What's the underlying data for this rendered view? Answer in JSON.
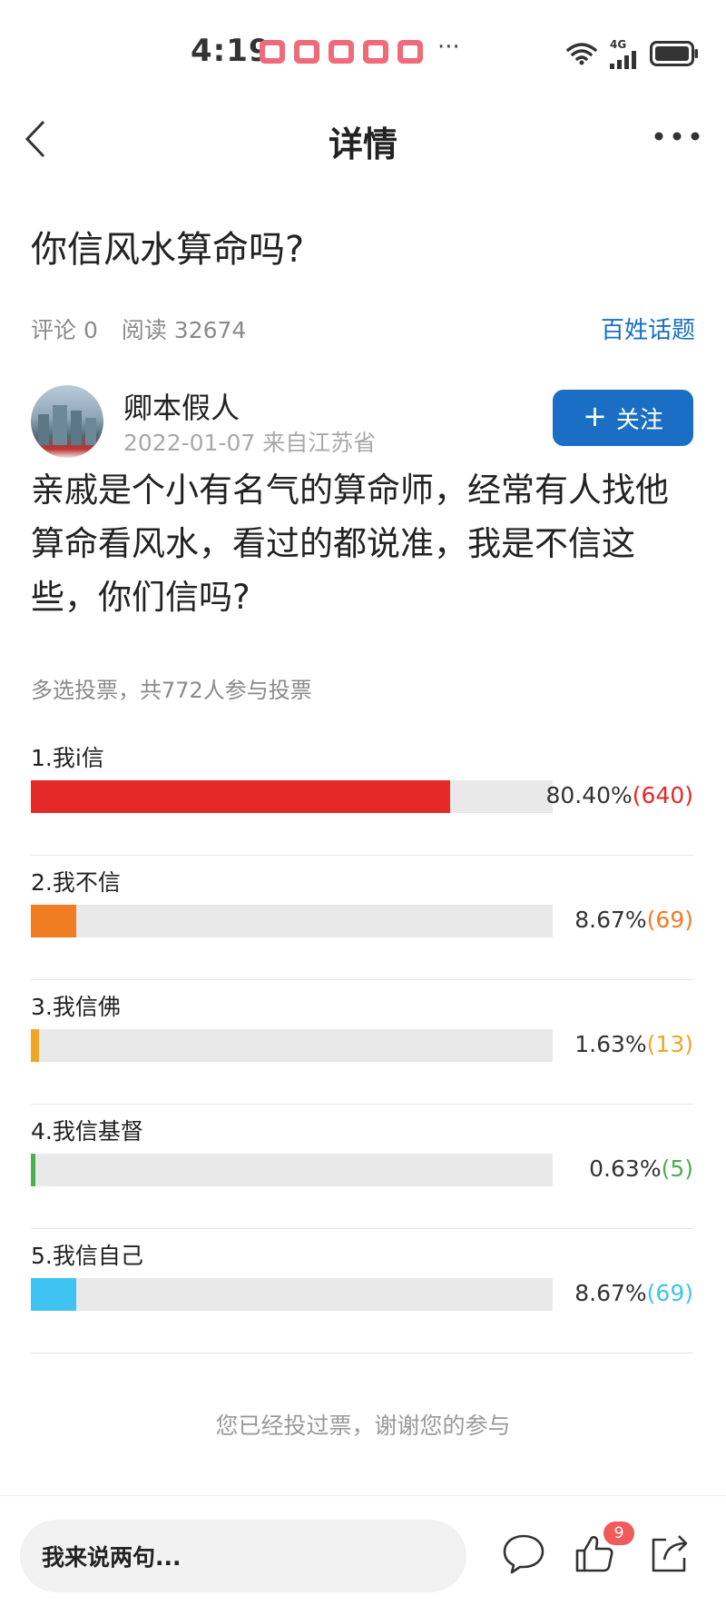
{
  "status_bar": {
    "time": "4:19",
    "notification_icons": [
      "xiaohongshu-icon",
      "xiaohongshu-icon",
      "xiaohongshu-icon",
      "xiaohongshu-icon",
      "xiaohongshu-icon"
    ],
    "more": "···",
    "network_label": "4G",
    "icons": [
      "wifi-icon",
      "signal-icon",
      "battery-icon"
    ]
  },
  "nav": {
    "title": "详情"
  },
  "topic": {
    "title": "你信风水算命吗?",
    "comments": "评论 0",
    "reads": "阅读 32674",
    "tag": "百姓话题"
  },
  "author": {
    "name": "卿本假人",
    "date_location": "2022-01-07 来自江苏省",
    "follow_label": "关注"
  },
  "post": {
    "body": "亲戚是个小有名气的算命师，经常有人找他算命看风水，看过的都说准，我是不信这些，你们信吗?"
  },
  "vote": {
    "summary": "多选投票，共772人参与投票",
    "options": [
      {
        "label": "1.我i信",
        "percent_text": "80.40%",
        "count_text": "(640)",
        "fraction": 0.804,
        "color": "#e52828"
      },
      {
        "label": "2.我不信",
        "percent_text": "8.67%",
        "count_text": "(69)",
        "fraction": 0.0867,
        "color": "#f07d22"
      },
      {
        "label": "3.我信佛",
        "percent_text": "1.63%",
        "count_text": "(13)",
        "fraction": 0.0163,
        "color": "#f0a624"
      },
      {
        "label": "4.我信基督",
        "percent_text": "0.63%",
        "count_text": "(5)",
        "fraction": 0.0063,
        "color": "#4caf50"
      },
      {
        "label": "5.我信自己",
        "percent_text": "8.67%",
        "count_text": "(69)",
        "fraction": 0.0867,
        "color": "#3fc3f0"
      }
    ],
    "voted_message": "您已经投过票，谢谢您的参与"
  },
  "bottom_bar": {
    "comment_placeholder": "我来说两句...",
    "like_count": "9"
  }
}
